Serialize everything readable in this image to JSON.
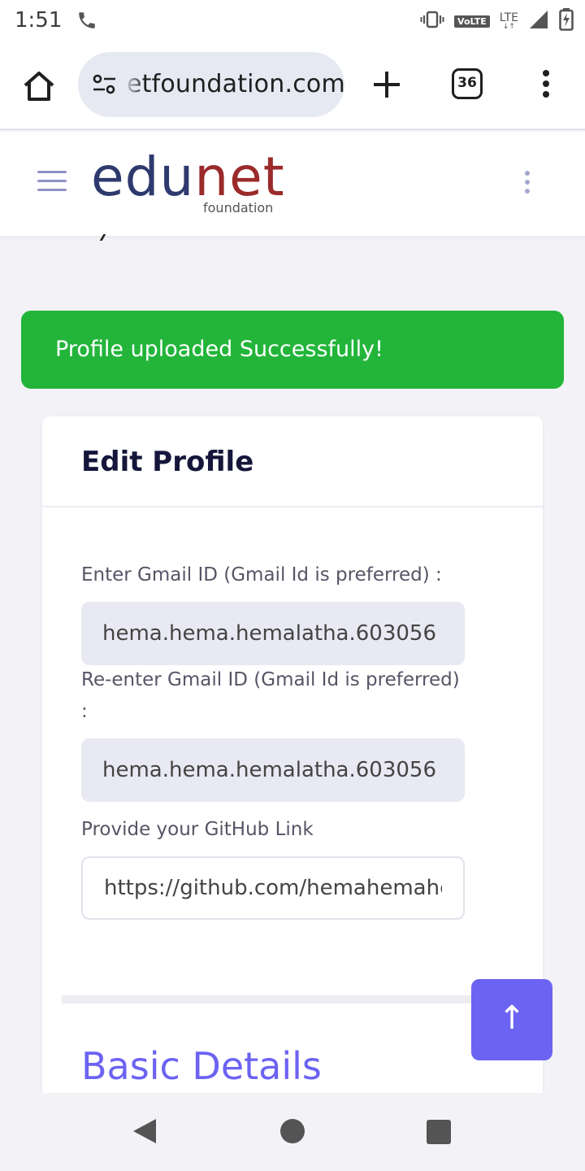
{
  "status_bar": {
    "time": "1:51",
    "volte": "VoLTE",
    "network": "LTE"
  },
  "browser": {
    "url": "etfoundation.com",
    "tab_count": "36"
  },
  "site": {
    "logo_edu": "edu",
    "logo_net": "net",
    "logo_sub": "foundation"
  },
  "alert": {
    "message": "Profile uploaded Successfully!",
    "color": "#22b53a"
  },
  "card": {
    "title": "Edit Profile",
    "fields": [
      {
        "label": "Enter Gmail ID (Gmail Id is preferred) :",
        "value": "hema.hema.hemalatha.603056"
      },
      {
        "label": "Re-enter Gmail ID (Gmail Id is preferred) :",
        "value": "hema.hema.hemalatha.603056"
      },
      {
        "label": "Provide your GitHub Link",
        "value": "https://github.com/hemahemahema"
      }
    ],
    "section_title": "Basic Details"
  },
  "scroll_top": {
    "glyph": "↑"
  },
  "colors": {
    "accent": "#6c63f2",
    "success": "#22b53a",
    "logo_edu": "#2e3a6e",
    "logo_net": "#9b2a2a"
  }
}
